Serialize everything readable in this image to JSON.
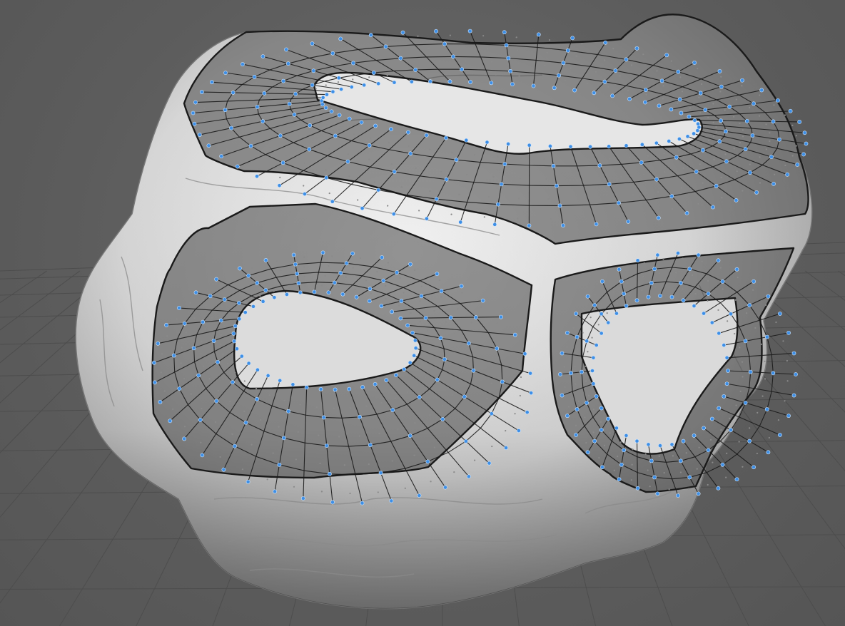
{
  "viewport": {
    "background_color": "#5f5f5f",
    "grid_color": "#4d4d4d",
    "sculpt_color": "#e2e2e2",
    "retopo_fill_color": "#464646",
    "edge_color": "#1a1a1a",
    "vertex_color": "#3e8fe6"
  },
  "scene": {
    "objects": [
      {
        "name": "sculpted-rock",
        "kind": "high-res sculpt mesh"
      },
      {
        "name": "retopology-mesh",
        "kind": "quad topology overlay"
      }
    ],
    "ground_grid": true,
    "visible_text": []
  }
}
